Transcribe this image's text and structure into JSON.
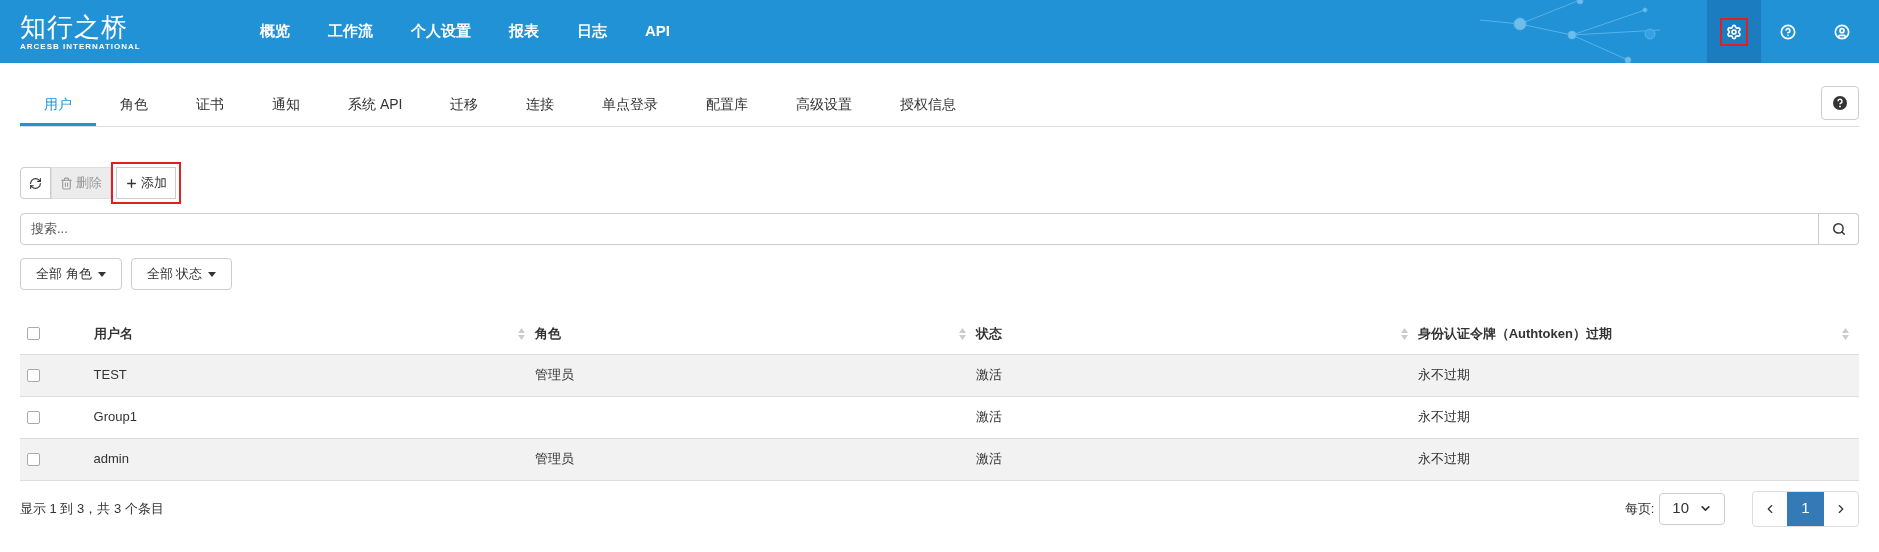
{
  "header": {
    "logo": {
      "title": "知行之桥",
      "subtitle": "ARCESB INTERNATIONAL"
    },
    "nav": [
      {
        "label": "概览"
      },
      {
        "label": "工作流"
      },
      {
        "label": "个人设置"
      },
      {
        "label": "报表"
      },
      {
        "label": "日志"
      },
      {
        "label": "API"
      }
    ],
    "icons": [
      {
        "kind": "settings",
        "selected": true,
        "highlighted": true
      },
      {
        "kind": "help",
        "selected": false,
        "highlighted": false
      },
      {
        "kind": "account",
        "selected": false,
        "highlighted": false
      }
    ]
  },
  "tabs": [
    {
      "label": "用户",
      "selected": true
    },
    {
      "label": "角色",
      "selected": false
    },
    {
      "label": "证书",
      "selected": false
    },
    {
      "label": "通知",
      "selected": false
    },
    {
      "label": "系统 API",
      "selected": false
    },
    {
      "label": "迁移",
      "selected": false
    },
    {
      "label": "连接",
      "selected": false
    },
    {
      "label": "单点登录",
      "selected": false
    },
    {
      "label": "配置库",
      "selected": false
    },
    {
      "label": "高级设置",
      "selected": false
    },
    {
      "label": "授权信息",
      "selected": false
    }
  ],
  "toolbar": [
    {
      "kind": "refresh",
      "disabled": false,
      "highlighted": false
    },
    {
      "kind": "delete",
      "label": "删除",
      "disabled": true,
      "highlighted": false
    },
    {
      "kind": "add",
      "label": "添加",
      "disabled": false,
      "highlighted": true
    }
  ],
  "search": {
    "placeholder": "搜索..."
  },
  "filters": [
    {
      "label": "全部 角色"
    },
    {
      "label": "全部 状态"
    }
  ],
  "table": {
    "all_checked": false,
    "columns": [
      "用户名",
      "角色",
      "状态",
      "身份认证令牌（Authtoken）过期"
    ],
    "rows": [
      {
        "checked": false,
        "cells": [
          "TEST",
          "管理员",
          "激活",
          "永不过期"
        ]
      },
      {
        "checked": false,
        "cells": [
          "Group1",
          "",
          "激活",
          "永不过期"
        ]
      },
      {
        "checked": false,
        "cells": [
          "admin",
          "管理员",
          "激活",
          "永不过期"
        ]
      }
    ]
  },
  "footer": {
    "summary": "显示 1 到 3，共 3 个条目",
    "page_size_label": "每页:",
    "page_size": "10",
    "pages": [
      {
        "label": "1",
        "selected": true
      }
    ]
  }
}
